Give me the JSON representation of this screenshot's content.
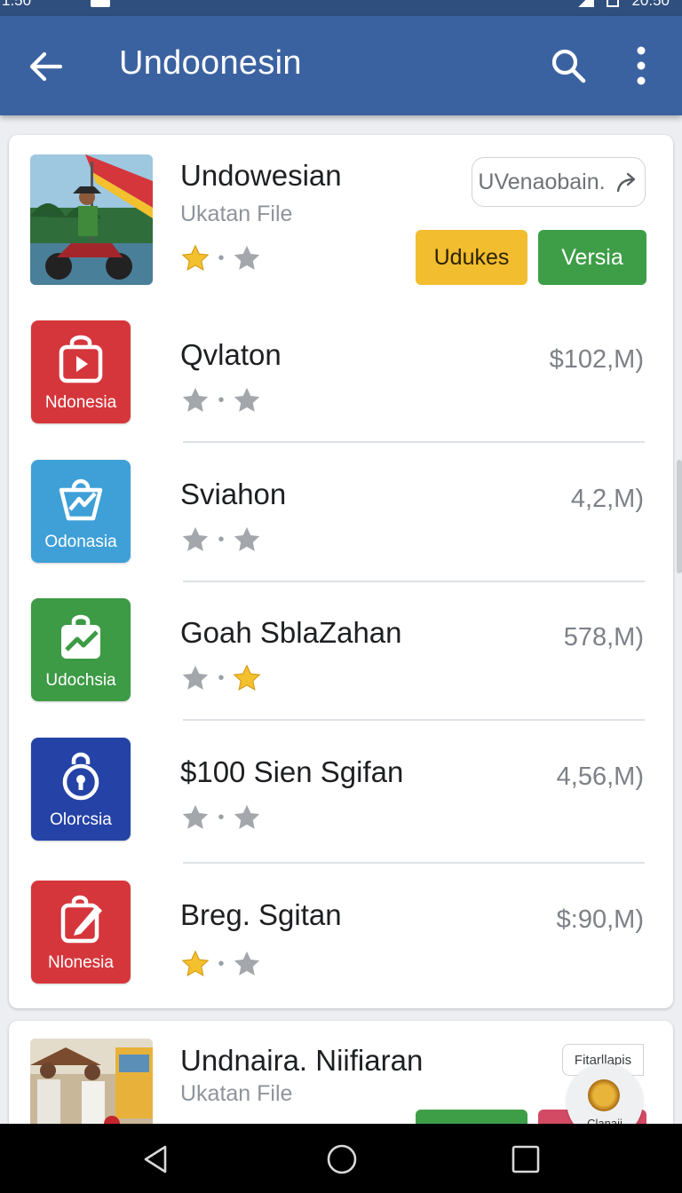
{
  "status_bar": {
    "time": "1:50",
    "clock_right": "20:50"
  },
  "app_bar": {
    "title": "Undoonesin",
    "back_icon": "arrow-left-icon",
    "search_icon": "search-icon",
    "more_icon": "more-vert-icon"
  },
  "featured": {
    "title": "Undowesian",
    "subtitle": "Ukatan File",
    "share_label": "UVenaobain.",
    "primary_button": "Udukes",
    "secondary_button": "Versia",
    "rating_stars": [
      "gold",
      "gray"
    ]
  },
  "apps": [
    {
      "name": "Qvlaton",
      "size": "$102,M)",
      "icon_label": "Ndonesia",
      "icon_color": "#d5363b",
      "icon": "play-bag-icon",
      "stars": [
        "gray",
        "gray"
      ]
    },
    {
      "name": "Sviahon",
      "size": "4,2,M)",
      "icon_label": "Odonasia",
      "icon_color": "#3fa0d8",
      "icon": "chart-bag-icon",
      "stars": [
        "gray",
        "gray"
      ]
    },
    {
      "name": "Goah SblaZahan",
      "size": "578,M)",
      "icon_label": "Udochsia",
      "icon_color": "#3d9a45",
      "icon": "trend-bag-icon",
      "stars": [
        "gray",
        "gold"
      ]
    },
    {
      "name": "$100 Sien Sgifan",
      "size": "4,56,M)",
      "icon_label": "Olorcsia",
      "icon_color": "#2543a6",
      "icon": "lock-icon",
      "stars": [
        "gray",
        "gray"
      ]
    },
    {
      "name": "Breg. Sgitan",
      "size": "$:90,M)",
      "icon_label": "Nlonesia",
      "icon_color": "#d5363b",
      "icon": "edit-bag-icon",
      "stars": [
        "gold",
        "gray"
      ]
    }
  ],
  "second_card": {
    "title": "Undnaira. Niifiaran",
    "subtitle": "Ukatan File",
    "tag": "Fitarllapis",
    "badge_caption": "Clanaii"
  },
  "colors": {
    "app_bar": "#3b62a0",
    "gold_star": "#f3c12e",
    "gray_star": "#a3a7ac",
    "green": "#3e9e47",
    "yellow": "#f2bd2f"
  },
  "nav": {
    "back": "nav-back-icon",
    "home": "nav-home-icon",
    "recents": "nav-recents-icon"
  }
}
